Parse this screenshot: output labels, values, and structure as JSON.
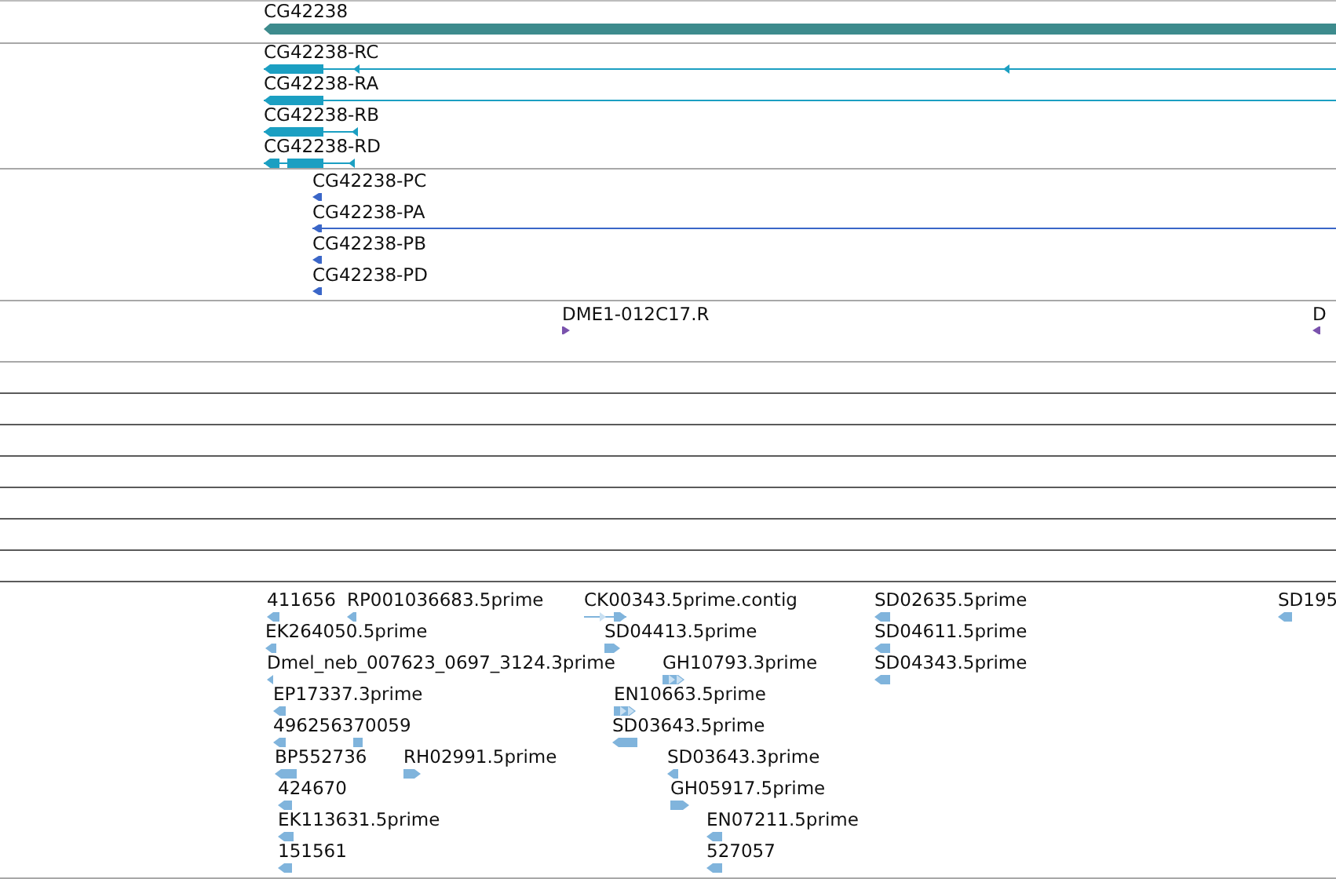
{
  "tracks": [
    {
      "kind": "gene",
      "features": [
        {
          "label": "CG42238",
          "reverse": true
        }
      ]
    },
    {
      "kind": "transcript",
      "features": [
        {
          "label": "CG42238-RC",
          "reverse": true
        },
        {
          "label": "CG42238-RA",
          "reverse": true
        },
        {
          "label": "CG42238-RB",
          "reverse": true
        },
        {
          "label": "CG42238-RD",
          "reverse": true
        }
      ]
    },
    {
      "kind": "protein",
      "features": [
        {
          "label": "CG42238-PC",
          "reverse": true
        },
        {
          "label": "CG42238-PA",
          "reverse": true
        },
        {
          "label": "CG42238-PB",
          "reverse": true
        },
        {
          "label": "CG42238-PD",
          "reverse": true
        }
      ]
    },
    {
      "kind": "est",
      "features": [
        {
          "label": "DME1-012C17.R",
          "reverse": false
        },
        {
          "label": "D",
          "reverse": true
        }
      ]
    },
    {
      "kind": "empty"
    },
    {
      "kind": "empty"
    },
    {
      "kind": "empty"
    },
    {
      "kind": "empty"
    },
    {
      "kind": "empty"
    },
    {
      "kind": "empty"
    },
    {
      "kind": "empty"
    },
    {
      "kind": "cdna",
      "features": [
        {
          "label": "411656",
          "reverse": true
        },
        {
          "label": "RP001036683.5prime",
          "reverse": true
        },
        {
          "label": "CK00343.5prime.contig",
          "reverse": false
        },
        {
          "label": "SD02635.5prime",
          "reverse": true
        },
        {
          "label": "SD195",
          "reverse": true
        },
        {
          "label": "EK264050.5prime",
          "reverse": true
        },
        {
          "label": "SD04413.5prime",
          "reverse": false
        },
        {
          "label": "SD04611.5prime",
          "reverse": true
        },
        {
          "label": "Dmel_neb_007623_0697_3124.3prime",
          "reverse": true
        },
        {
          "label": "GH10793.3prime",
          "reverse": false
        },
        {
          "label": "SD04343.5prime",
          "reverse": true
        },
        {
          "label": "EP17337.3prime",
          "reverse": true
        },
        {
          "label": "EN10663.5prime",
          "reverse": false
        },
        {
          "label": "496256370059",
          "reverse": true
        },
        {
          "label": "SD03643.5prime",
          "reverse": true
        },
        {
          "label": "BP552736",
          "reverse": true
        },
        {
          "label": "RH02991.5prime",
          "reverse": false
        },
        {
          "label": "SD03643.3prime",
          "reverse": true
        },
        {
          "label": "424670",
          "reverse": true
        },
        {
          "label": "GH05917.5prime",
          "reverse": false
        },
        {
          "label": "EK113631.5prime",
          "reverse": true
        },
        {
          "label": "EN07211.5prime",
          "reverse": true
        },
        {
          "label": "151561",
          "reverse": true
        },
        {
          "label": "527057",
          "reverse": true
        }
      ]
    }
  ]
}
